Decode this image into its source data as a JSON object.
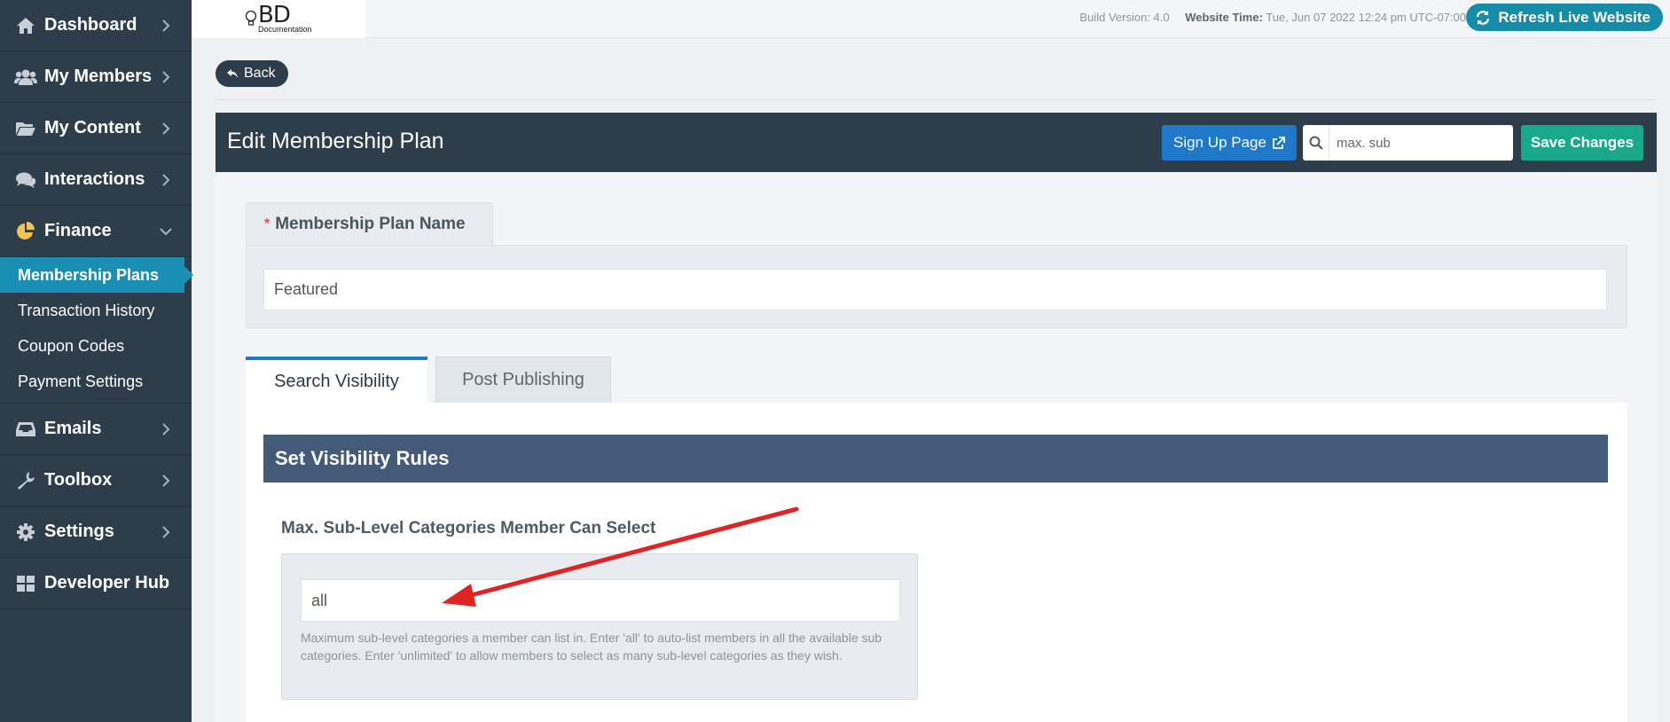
{
  "sidebar": {
    "items": [
      {
        "label": "Dashboard",
        "icon": "home-icon"
      },
      {
        "label": "My Members",
        "icon": "users-icon"
      },
      {
        "label": "My Content",
        "icon": "folder-icon"
      },
      {
        "label": "Interactions",
        "icon": "comments-icon"
      },
      {
        "label": "Finance",
        "icon": "pie-chart-icon",
        "expanded": true
      },
      {
        "label": "Emails",
        "icon": "inbox-icon"
      },
      {
        "label": "Toolbox",
        "icon": "wrench-icon"
      },
      {
        "label": "Settings",
        "icon": "gear-icon"
      },
      {
        "label": "Developer Hub",
        "icon": "grid-icon"
      }
    ],
    "finance_sub": [
      {
        "label": "Membership Plans",
        "active": true
      },
      {
        "label": "Transaction History"
      },
      {
        "label": "Coupon Codes"
      },
      {
        "label": "Payment Settings"
      }
    ]
  },
  "topbar": {
    "logo_main": "BD",
    "logo_sub": "Documentation",
    "build_version": "Build Version: 4.0",
    "website_time_label": "Website Time:",
    "website_time_value": "Tue, Jun 07 2022 12:24 pm UTC-07:00",
    "refresh_label": "Refresh Live Website"
  },
  "back_label": "Back",
  "panel": {
    "title": "Edit Membership Plan",
    "signup_label": "Sign Up Page",
    "search_value": "max. sub",
    "save_label": "Save Changes"
  },
  "plan_name": {
    "required_mark": "*",
    "label": "Membership Plan Name",
    "value": "Featured"
  },
  "tabs": [
    {
      "label": "Search Visibility",
      "active": true
    },
    {
      "label": "Post Publishing",
      "active": false
    }
  ],
  "visibility": {
    "section_title": "Set Visibility Rules",
    "field_label": "Max. Sub-Level Categories Member Can Select",
    "field_value": "all",
    "help_text": "Maximum sub-level categories a member can list in. Enter 'all' to auto-list members in all the available sub categories. Enter 'unlimited' to allow members to select as many sub-level categories as they wish."
  },
  "colors": {
    "sidebar_bg": "#2e3d4b",
    "active_accent": "#1b8fb3",
    "save_green": "#1aa88c",
    "signup_blue": "#1f78c8",
    "section_bar": "#435b78",
    "annotation_red": "#e02424"
  }
}
